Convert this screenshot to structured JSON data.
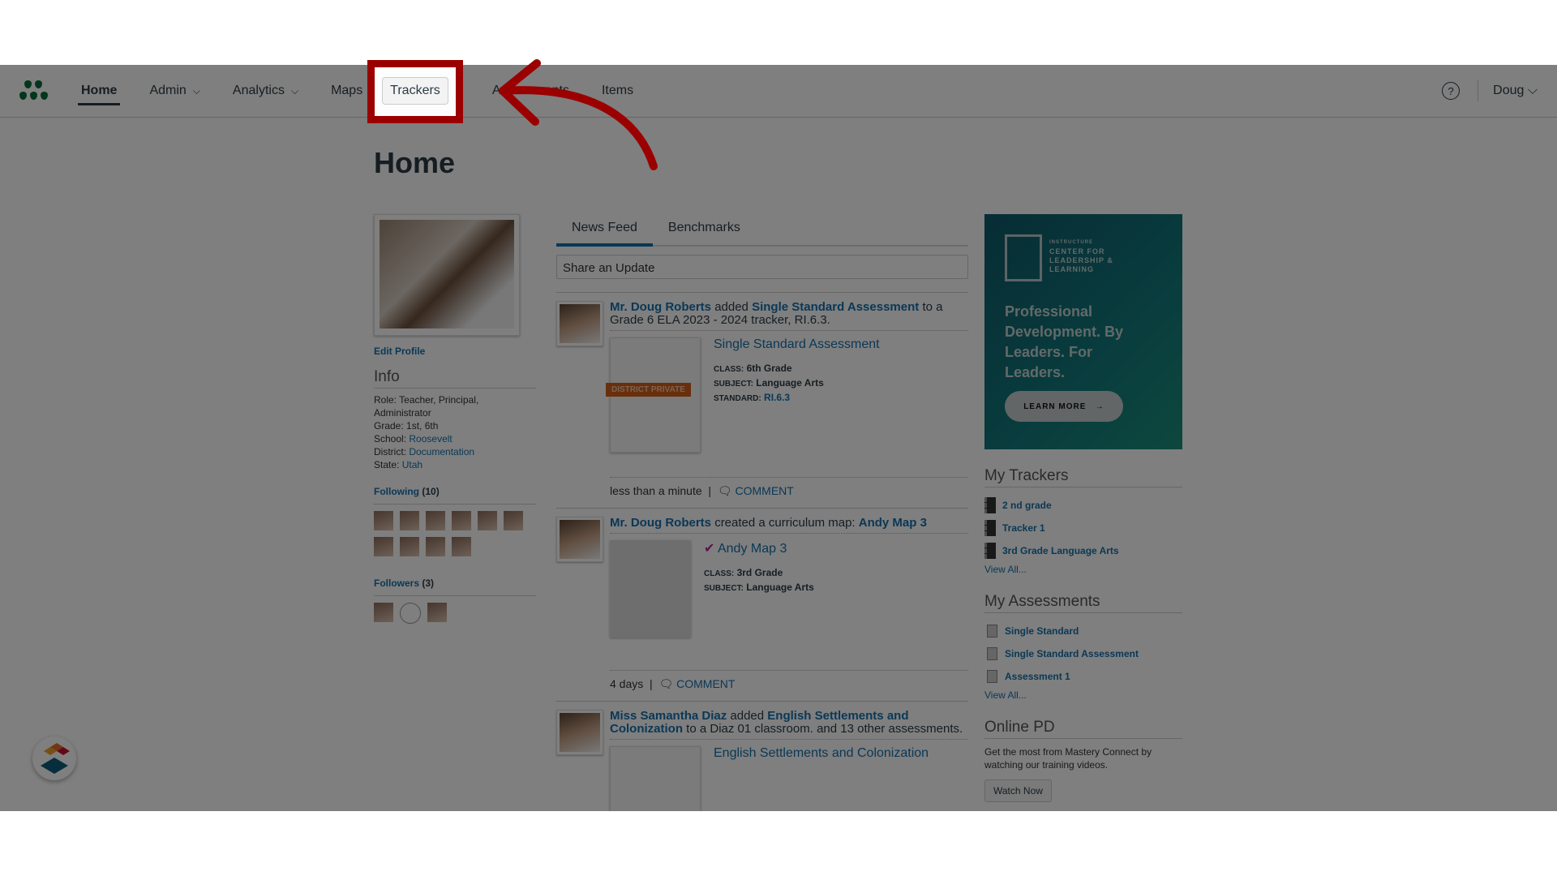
{
  "nav": {
    "items": [
      {
        "label": "Home",
        "active": true
      },
      {
        "label": "Admin",
        "dropdown": true
      },
      {
        "label": "Analytics",
        "dropdown": true
      },
      {
        "label": "Maps"
      },
      {
        "label": "Trackers",
        "highlighted": true
      },
      {
        "label": "Assessments"
      },
      {
        "label": "Items"
      }
    ],
    "help_icon": "question-circle-icon",
    "user": "Doug"
  },
  "page": {
    "title": "Home"
  },
  "profile": {
    "edit_label": "Edit Profile",
    "info_heading": "Info",
    "role_label": "Role:",
    "role": "Teacher, Principal, Administrator",
    "grade_label": "Grade:",
    "grade": "1st, 6th",
    "school_label": "School:",
    "school": "Roosevelt",
    "district_label": "District:",
    "district": "Documentation",
    "state_label": "State:",
    "state": "Utah",
    "following_label": "Following",
    "following_count": "(10)",
    "followers_label": "Followers",
    "followers_count": "(3)"
  },
  "feed": {
    "tabs": [
      {
        "label": "News Feed",
        "active": true
      },
      {
        "label": "Benchmarks"
      }
    ],
    "share_placeholder": "Share an Update",
    "items": [
      {
        "actor": "Mr. Doug Roberts",
        "verb": "added",
        "object": "Single Standard Assessment",
        "rest": "to a Grade 6 ELA 2023 - 2024 tracker, RI.6.3.",
        "card_title": "Single Standard Assessment",
        "badge": "DISTRICT PRIVATE",
        "class_label": "CLASS:",
        "class": "6th Grade",
        "subject_label": "SUBJECT:",
        "subject": "Language Arts",
        "standard_label": "STANDARD:",
        "standard": "RI.6.3",
        "time": "less than a minute",
        "comment": "COMMENT"
      },
      {
        "actor": "Mr. Doug Roberts",
        "verb": "created a curriculum map:",
        "object": "Andy Map 3",
        "card_title": "Andy Map 3",
        "class_label": "CLASS:",
        "class": "3rd Grade",
        "subject_label": "SUBJECT:",
        "subject": "Language Arts",
        "time": "4 days",
        "comment": "COMMENT"
      },
      {
        "actor": "Miss Samantha Diaz",
        "verb": "added",
        "object": "English Settlements and Colonization",
        "rest": "to a Diaz 01 classroom. and 13 other assessments.",
        "card_title": "English Settlements and Colonization"
      }
    ]
  },
  "sidebar": {
    "ad": {
      "brand_small": "INSTRUCTURE",
      "brand": "CENTER FOR LEADERSHIP & LEARNING",
      "headline": "Professional Development. By Leaders. For Leaders.",
      "cta": "LEARN MORE"
    },
    "trackers_heading": "My Trackers",
    "trackers": [
      "2 nd grade",
      "Tracker 1",
      "3rd Grade Language Arts"
    ],
    "assessments_heading": "My Assessments",
    "assessments": [
      "Single Standard",
      "Single Standard Assessment",
      "Assessment 1"
    ],
    "view_all": "View All...",
    "online_pd_heading": "Online PD",
    "online_pd_text": "Get the most from Mastery Connect by watching our training videos.",
    "watch_now": "Watch Now"
  },
  "colors": {
    "accent": "#1770ab",
    "highlight": "#9b0000",
    "logo": "#0b6b3a"
  }
}
